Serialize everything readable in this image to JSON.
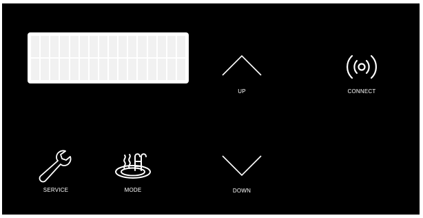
{
  "panel": {
    "display": {
      "icon": "lcd-display",
      "rows": 2,
      "columns": 16
    },
    "buttons": {
      "up": {
        "label": "UP",
        "icon": "chevron-up-icon"
      },
      "down": {
        "label": "DOWN",
        "icon": "chevron-down-icon"
      },
      "connect": {
        "label": "CONNECT",
        "icon": "wireless-signal-icon"
      },
      "service": {
        "label": "SERVICE",
        "icon": "wrench-icon"
      },
      "mode": {
        "label": "MODE",
        "icon": "pool-ladder-icon"
      }
    },
    "colors": {
      "background": "#000000",
      "foreground": "#ffffff",
      "lcd": "#ffffff"
    }
  }
}
